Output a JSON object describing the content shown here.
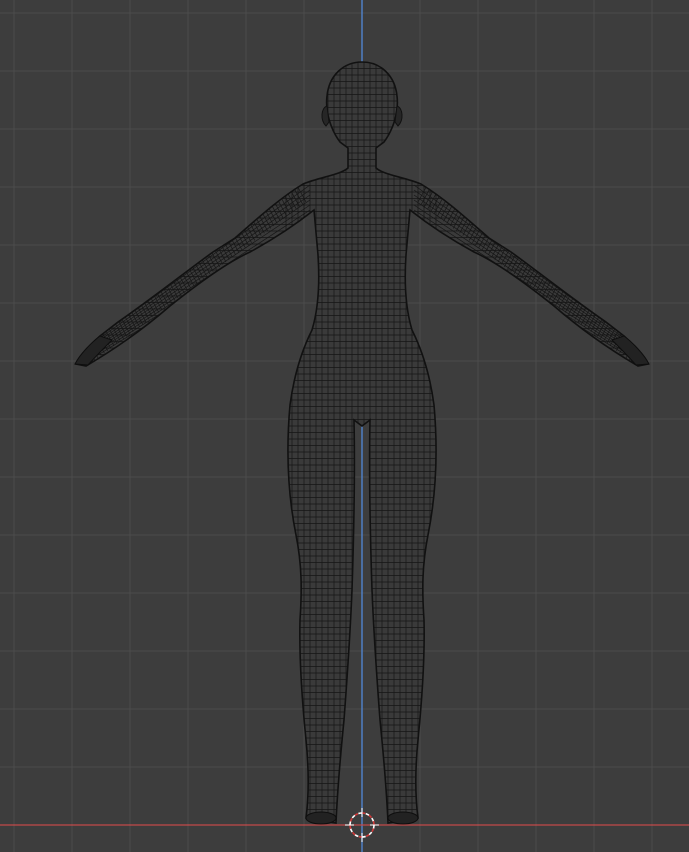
{
  "viewport": {
    "view": "back-orthographic",
    "display_mode": "wireframe",
    "background_color": "#3d3d3d",
    "grid_color": "#4c4c4c",
    "z_axis_color": "#4f7fc4",
    "x_axis_color": "#c24a4a",
    "wire_color": "#111111",
    "cursor_color": "#ffffff",
    "cursor_accent": "#d33a3a"
  },
  "objects": [
    {
      "name": "human-figure",
      "type": "mesh",
      "pose": "a-pose"
    }
  ],
  "overlays": {
    "grid": true,
    "axes": [
      "X",
      "Z"
    ],
    "cursor_3d": true
  }
}
